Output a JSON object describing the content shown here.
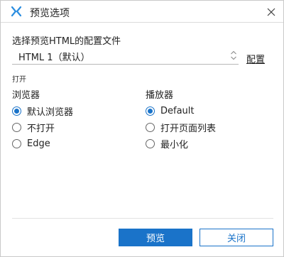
{
  "window": {
    "title": "预览选项"
  },
  "file_select": {
    "label": "选择预览HTML的配置文件",
    "value": "HTML 1（默认）",
    "config_link": "配置"
  },
  "open_group": {
    "label": "打开"
  },
  "browser": {
    "title": "浏览器",
    "options": [
      {
        "label": "默认浏览器",
        "checked": true
      },
      {
        "label": "不打开",
        "checked": false
      },
      {
        "label": "Edge",
        "checked": false
      }
    ]
  },
  "player": {
    "title": "播放器",
    "options": [
      {
        "label": "Default",
        "checked": true
      },
      {
        "label": "打开页面列表",
        "checked": false
      },
      {
        "label": "最小化",
        "checked": false
      }
    ]
  },
  "buttons": {
    "preview": "预览",
    "close": "关闭"
  },
  "colors": {
    "accent": "#1a73c9"
  }
}
